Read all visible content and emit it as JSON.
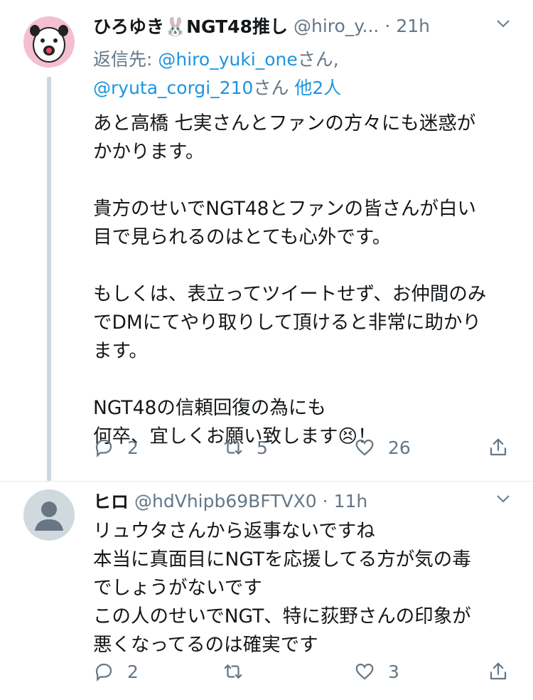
{
  "colors": {
    "accent": "#1b95e0",
    "muted": "#657786",
    "text": "#14171a",
    "thread_line": "#ccd6dd"
  },
  "tweet1": {
    "display_name": "ひろゆき🐰NGT48推し",
    "handle": "@hiro_y...",
    "separator": "·",
    "time": "21h",
    "chevron": "⌵",
    "reply_prefix": "返信先: ",
    "reply_user1": "@hiro_yuki_one",
    "reply_suffix1": "さん,",
    "reply_user2": "@ryuta_corgi_210",
    "reply_suffix2": "さん ",
    "reply_others": "他2人",
    "text": "あと高橋 七実さんとファンの方々にも迷惑が\nかかります。\n\n貴方のせいでNGT48とファンの皆さんが白い\n目で見られるのはとても心外です。\n\nもしくは、表立ってツイートせず、お仲間のみ\nでDMにてやり取りして頂けると非常に助かり\nます。\n\nNGT48の信頼回復の為にも\n何卒、宜しくお願い致します😣！",
    "replies": "2",
    "retweets": "5",
    "likes": "26",
    "avatar_icon": "cartoon-face-avatar"
  },
  "tweet2": {
    "display_name": "ヒロ",
    "handle": "@hdVhipb69BFTVX0",
    "separator": "·",
    "time": "11h",
    "chevron": "⌵",
    "text": "リュウタさんから返事ないですね\n本当に真面目にNGTを応援してる方が気の毒\nでしょうがないです\nこの人のせいでNGT、特に荻野さんの印象が\n悪くなってるのは確実です",
    "replies": "2",
    "retweets": "",
    "likes": "3",
    "avatar_icon": "default-user-avatar"
  }
}
